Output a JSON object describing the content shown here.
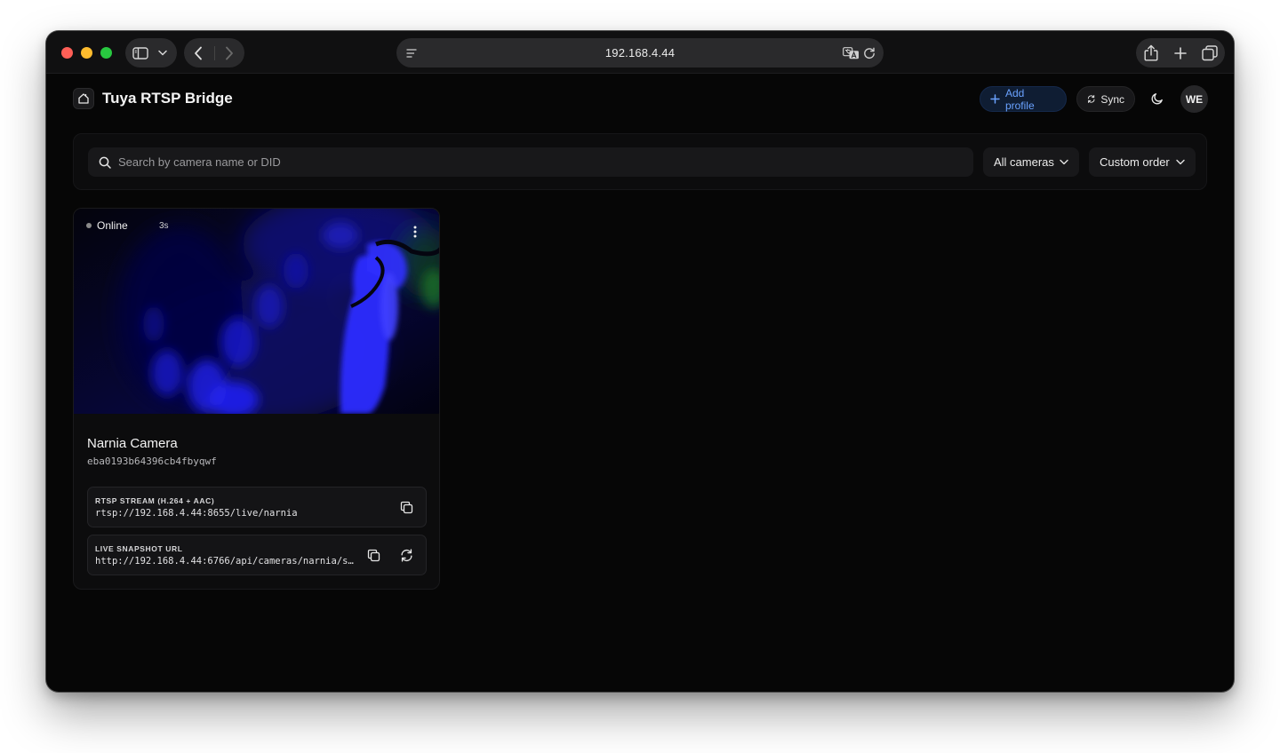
{
  "browser": {
    "url": "192.168.4.44"
  },
  "app": {
    "title": "Tuya RTSP Bridge",
    "add_profile_label": "Add profile",
    "sync_label": "Sync",
    "avatar_initials": "WE",
    "accent_color": "#6aa2ff"
  },
  "filters": {
    "search_placeholder": "Search by camera name or DID",
    "search_value": "",
    "camera_filter": "All cameras",
    "sort_order": "Custom order"
  },
  "cameras": [
    {
      "status": "Online",
      "age": "3s",
      "name": "Narnia Camera",
      "did": "eba0193b64396cb4fbyqwf",
      "rtsp_label": "RTSP STREAM (H.264 + AAC)",
      "rtsp_url": "rtsp://192.168.4.44:8655/live/narnia",
      "snapshot_label": "LIVE SNAPSHOT URL",
      "snapshot_url": "http://192.168.4.44:6766/api/cameras/narnia/s…"
    }
  ],
  "icons": {
    "logo": "home-icon",
    "add": "plus-icon",
    "sync": "refresh-icon",
    "theme": "moon-icon",
    "search": "search-icon",
    "dropdown": "chevron-down-icon",
    "menu": "more-vertical-icon",
    "copy": "copy-icon",
    "refresh": "refresh-icon"
  }
}
